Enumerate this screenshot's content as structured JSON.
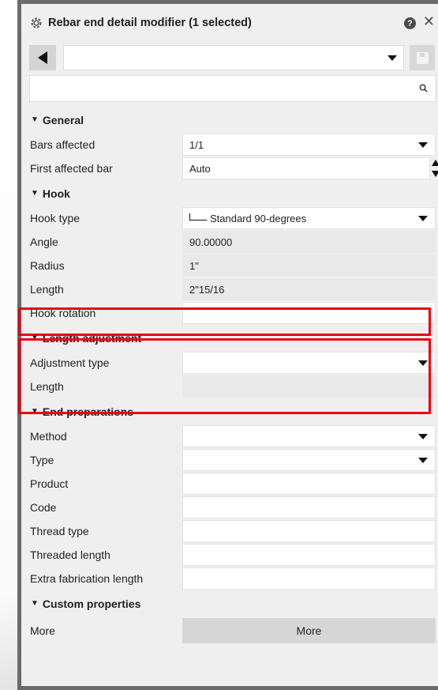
{
  "window": {
    "title": "Rebar end detail modifier (1 selected)"
  },
  "toolbar": {
    "preset_value": ""
  },
  "search": {
    "placeholder": ""
  },
  "sections": {
    "general": "General",
    "hook": "Hook",
    "length_adjustment": "Length adjustment",
    "end_preparations": "End preparations",
    "custom_properties": "Custom properties"
  },
  "general": {
    "bars_affected": {
      "label": "Bars affected",
      "value": "1/1"
    },
    "first_affected_bar": {
      "label": "First affected bar",
      "value": "Auto"
    }
  },
  "hook": {
    "hook_type": {
      "label": "Hook type",
      "value": "Standard 90-degrees"
    },
    "angle": {
      "label": "Angle",
      "value": "90.00000"
    },
    "radius": {
      "label": "Radius",
      "value": "1\""
    },
    "length": {
      "label": "Length",
      "value": "2\"15/16"
    },
    "hook_rotation": {
      "label": "Hook rotation",
      "value": ""
    }
  },
  "length_adjustment": {
    "adjustment_type": {
      "label": "Adjustment type",
      "value": ""
    },
    "length": {
      "label": "Length",
      "value": ""
    }
  },
  "end_preparations": {
    "method": {
      "label": "Method",
      "value": ""
    },
    "type": {
      "label": "Type",
      "value": ""
    },
    "product": {
      "label": "Product",
      "value": ""
    },
    "code": {
      "label": "Code",
      "value": ""
    },
    "thread_type": {
      "label": "Thread type",
      "value": ""
    },
    "threaded_length": {
      "label": "Threaded length",
      "value": ""
    },
    "extra_fabrication_length": {
      "label": "Extra fabrication length",
      "value": ""
    }
  },
  "custom_properties": {
    "more": {
      "label": "More",
      "button": "More"
    }
  },
  "highlight_color": "#e8000b"
}
